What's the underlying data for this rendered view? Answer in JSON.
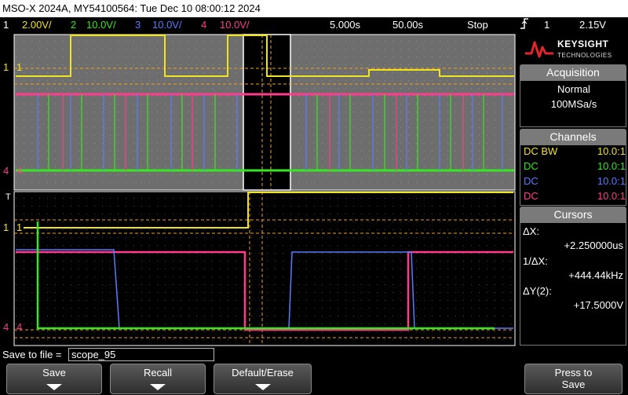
{
  "title": "MSO-X 2024A, MY54100564: Tue Dec 10 08:00:12 2024",
  "status": {
    "ch1": {
      "num": "1",
      "scale": "2.00V/"
    },
    "ch2": {
      "num": "2",
      "scale": "10.0V/"
    },
    "ch3": {
      "num": "3",
      "scale": "10.0V/"
    },
    "ch4": {
      "num": "4",
      "scale": "10.0V/"
    },
    "delay": "5.000s",
    "timebase": "50.00s",
    "run_state": "Stop",
    "trigger_source": "1",
    "trigger_level": "2.15V",
    "trigger_icon": "trigger-rising-edge-icon"
  },
  "brand": {
    "name": "KEYSIGHT",
    "sub": "TECHNOLOGIES"
  },
  "acquisition": {
    "header": "Acquisition",
    "mode": "Normal",
    "rate": "100MSa/s"
  },
  "channels": {
    "header": "Channels",
    "rows": [
      {
        "coupling": "DC BW",
        "probe": "10.0:1",
        "color": "#f0e41e"
      },
      {
        "coupling": "DC",
        "probe": "10.0:1",
        "color": "#35e81f"
      },
      {
        "coupling": "DC",
        "probe": "10.0:1",
        "color": "#5b7bff"
      },
      {
        "coupling": "DC",
        "probe": "10.0:1",
        "color": "#ff3c8c"
      }
    ]
  },
  "cursors": {
    "header": "Cursors",
    "dx_label": "ΔX:",
    "dx_value": "+2.250000us",
    "inv_label": "1/ΔX:",
    "inv_value": "+444.44kHz",
    "dy_label": "ΔY(2):",
    "dy_value": "+17.5000V"
  },
  "markers": {
    "ch1": "1",
    "ch4": "4",
    "trig": "T"
  },
  "save": {
    "label": "Save to file =",
    "filename": "scope_95"
  },
  "softkeys": {
    "save": "Save",
    "recall": "Recall",
    "default_erase": "Default/Erase",
    "press_to_save_1": "Press to",
    "press_to_save_2": "Save"
  },
  "colors": {
    "ch1": "#f0e41e",
    "ch2": "#35e81f",
    "ch3": "#5b7bff",
    "ch4": "#ff3c8c",
    "grid_bg": "#767676",
    "zoom_bg": "#000000"
  }
}
